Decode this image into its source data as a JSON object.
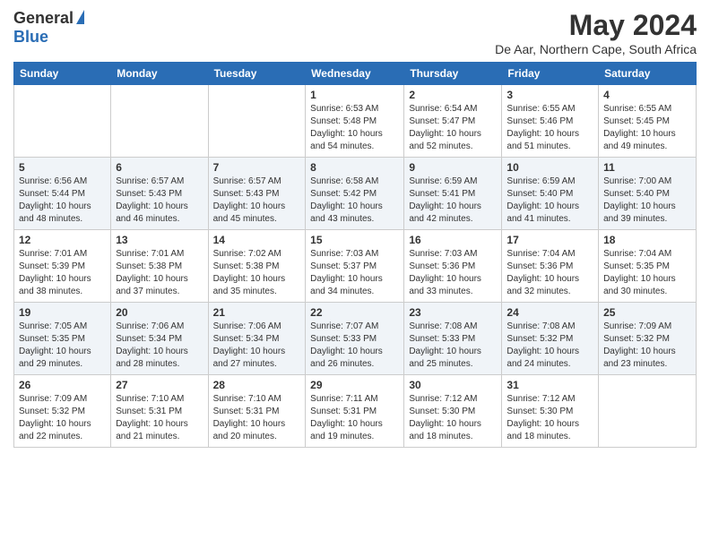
{
  "logo": {
    "line1": "General",
    "line2": "Blue"
  },
  "title": "May 2024",
  "location": "De Aar, Northern Cape, South Africa",
  "days_of_week": [
    "Sunday",
    "Monday",
    "Tuesday",
    "Wednesday",
    "Thursday",
    "Friday",
    "Saturday"
  ],
  "weeks": [
    [
      {
        "day": "",
        "info": ""
      },
      {
        "day": "",
        "info": ""
      },
      {
        "day": "",
        "info": ""
      },
      {
        "day": "1",
        "info": "Sunrise: 6:53 AM\nSunset: 5:48 PM\nDaylight: 10 hours\nand 54 minutes."
      },
      {
        "day": "2",
        "info": "Sunrise: 6:54 AM\nSunset: 5:47 PM\nDaylight: 10 hours\nand 52 minutes."
      },
      {
        "day": "3",
        "info": "Sunrise: 6:55 AM\nSunset: 5:46 PM\nDaylight: 10 hours\nand 51 minutes."
      },
      {
        "day": "4",
        "info": "Sunrise: 6:55 AM\nSunset: 5:45 PM\nDaylight: 10 hours\nand 49 minutes."
      }
    ],
    [
      {
        "day": "5",
        "info": "Sunrise: 6:56 AM\nSunset: 5:44 PM\nDaylight: 10 hours\nand 48 minutes."
      },
      {
        "day": "6",
        "info": "Sunrise: 6:57 AM\nSunset: 5:43 PM\nDaylight: 10 hours\nand 46 minutes."
      },
      {
        "day": "7",
        "info": "Sunrise: 6:57 AM\nSunset: 5:43 PM\nDaylight: 10 hours\nand 45 minutes."
      },
      {
        "day": "8",
        "info": "Sunrise: 6:58 AM\nSunset: 5:42 PM\nDaylight: 10 hours\nand 43 minutes."
      },
      {
        "day": "9",
        "info": "Sunrise: 6:59 AM\nSunset: 5:41 PM\nDaylight: 10 hours\nand 42 minutes."
      },
      {
        "day": "10",
        "info": "Sunrise: 6:59 AM\nSunset: 5:40 PM\nDaylight: 10 hours\nand 41 minutes."
      },
      {
        "day": "11",
        "info": "Sunrise: 7:00 AM\nSunset: 5:40 PM\nDaylight: 10 hours\nand 39 minutes."
      }
    ],
    [
      {
        "day": "12",
        "info": "Sunrise: 7:01 AM\nSunset: 5:39 PM\nDaylight: 10 hours\nand 38 minutes."
      },
      {
        "day": "13",
        "info": "Sunrise: 7:01 AM\nSunset: 5:38 PM\nDaylight: 10 hours\nand 37 minutes."
      },
      {
        "day": "14",
        "info": "Sunrise: 7:02 AM\nSunset: 5:38 PM\nDaylight: 10 hours\nand 35 minutes."
      },
      {
        "day": "15",
        "info": "Sunrise: 7:03 AM\nSunset: 5:37 PM\nDaylight: 10 hours\nand 34 minutes."
      },
      {
        "day": "16",
        "info": "Sunrise: 7:03 AM\nSunset: 5:36 PM\nDaylight: 10 hours\nand 33 minutes."
      },
      {
        "day": "17",
        "info": "Sunrise: 7:04 AM\nSunset: 5:36 PM\nDaylight: 10 hours\nand 32 minutes."
      },
      {
        "day": "18",
        "info": "Sunrise: 7:04 AM\nSunset: 5:35 PM\nDaylight: 10 hours\nand 30 minutes."
      }
    ],
    [
      {
        "day": "19",
        "info": "Sunrise: 7:05 AM\nSunset: 5:35 PM\nDaylight: 10 hours\nand 29 minutes."
      },
      {
        "day": "20",
        "info": "Sunrise: 7:06 AM\nSunset: 5:34 PM\nDaylight: 10 hours\nand 28 minutes."
      },
      {
        "day": "21",
        "info": "Sunrise: 7:06 AM\nSunset: 5:34 PM\nDaylight: 10 hours\nand 27 minutes."
      },
      {
        "day": "22",
        "info": "Sunrise: 7:07 AM\nSunset: 5:33 PM\nDaylight: 10 hours\nand 26 minutes."
      },
      {
        "day": "23",
        "info": "Sunrise: 7:08 AM\nSunset: 5:33 PM\nDaylight: 10 hours\nand 25 minutes."
      },
      {
        "day": "24",
        "info": "Sunrise: 7:08 AM\nSunset: 5:32 PM\nDaylight: 10 hours\nand 24 minutes."
      },
      {
        "day": "25",
        "info": "Sunrise: 7:09 AM\nSunset: 5:32 PM\nDaylight: 10 hours\nand 23 minutes."
      }
    ],
    [
      {
        "day": "26",
        "info": "Sunrise: 7:09 AM\nSunset: 5:32 PM\nDaylight: 10 hours\nand 22 minutes."
      },
      {
        "day": "27",
        "info": "Sunrise: 7:10 AM\nSunset: 5:31 PM\nDaylight: 10 hours\nand 21 minutes."
      },
      {
        "day": "28",
        "info": "Sunrise: 7:10 AM\nSunset: 5:31 PM\nDaylight: 10 hours\nand 20 minutes."
      },
      {
        "day": "29",
        "info": "Sunrise: 7:11 AM\nSunset: 5:31 PM\nDaylight: 10 hours\nand 19 minutes."
      },
      {
        "day": "30",
        "info": "Sunrise: 7:12 AM\nSunset: 5:30 PM\nDaylight: 10 hours\nand 18 minutes."
      },
      {
        "day": "31",
        "info": "Sunrise: 7:12 AM\nSunset: 5:30 PM\nDaylight: 10 hours\nand 18 minutes."
      },
      {
        "day": "",
        "info": ""
      }
    ]
  ]
}
